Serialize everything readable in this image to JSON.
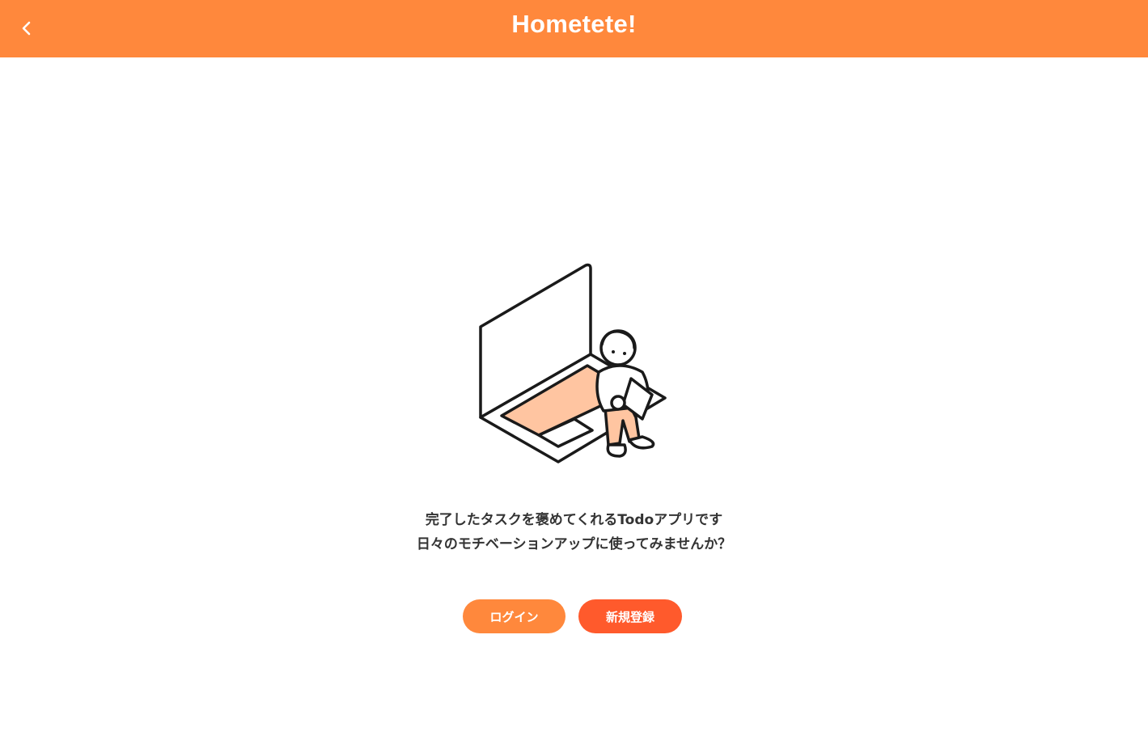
{
  "header": {
    "title": "Hometete!",
    "back_icon": "chevron-left-icon",
    "color": "#ff883c"
  },
  "main": {
    "tagline_line1": "完了したタスクを褒めてくれるTodoアプリです",
    "tagline_line2": "日々のモチベーションアップに使ってみませんか？",
    "illustration": "person-sitting-on-laptop-illustration"
  },
  "actions": {
    "login_label": "ログイン",
    "signup_label": "新規登録",
    "login_color": "#ff883c",
    "signup_color": "#ff5a2c"
  }
}
